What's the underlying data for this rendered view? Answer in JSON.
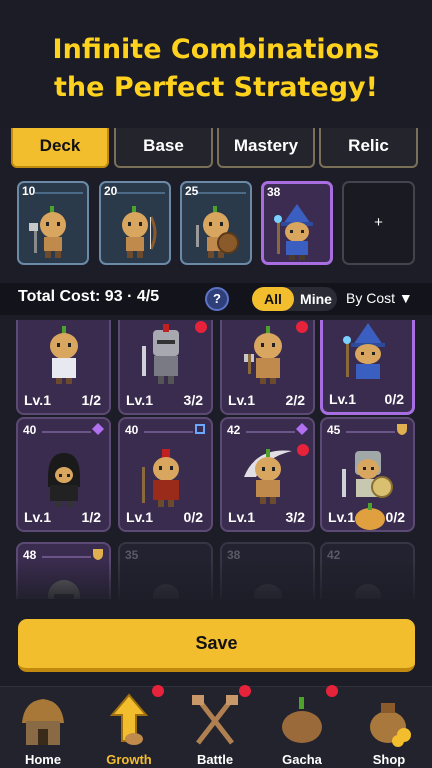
{
  "banner": {
    "line1": "Infinite Combinations",
    "line2": "the Perfect Strategy!"
  },
  "tabs": [
    {
      "label": "Deck",
      "active": true
    },
    {
      "label": "Base",
      "active": false
    },
    {
      "label": "Mastery",
      "active": false
    },
    {
      "label": "Relic",
      "active": false
    }
  ],
  "deck": [
    {
      "cost": "10"
    },
    {
      "cost": "20"
    },
    {
      "cost": "25"
    },
    {
      "cost": "38"
    }
  ],
  "add_slot": {
    "label": "+"
  },
  "summary": {
    "total_cost": "Total Cost: 93",
    "separator": "·",
    "slots": "4/5",
    "help": "?"
  },
  "filter": {
    "all": "All",
    "mine": "Mine",
    "sort": "By Cost ▼"
  },
  "units": [
    {
      "cost": "",
      "level": "Lv.1",
      "count": "1/2"
    },
    {
      "cost": "",
      "level": "Lv.1",
      "count": "3/2"
    },
    {
      "cost": "",
      "level": "Lv.1",
      "count": "2/2"
    },
    {
      "cost": "",
      "level": "Lv.1",
      "count": "0/2"
    },
    {
      "cost": "40",
      "level": "Lv.1",
      "count": "1/2"
    },
    {
      "cost": "40",
      "level": "Lv.1",
      "count": "0/2"
    },
    {
      "cost": "42",
      "level": "Lv.1",
      "count": "3/2"
    },
    {
      "cost": "45",
      "level": "Lv.1",
      "count": "0/2"
    },
    {
      "cost": "48",
      "level": "",
      "count": ""
    },
    {
      "cost": "35",
      "level": "",
      "count": ""
    },
    {
      "cost": "38",
      "level": "",
      "count": ""
    },
    {
      "cost": "42",
      "level": "",
      "count": ""
    }
  ],
  "save": {
    "label": "Save"
  },
  "nav": [
    {
      "label": "Home",
      "icon": "hut-icon"
    },
    {
      "label": "Growth",
      "icon": "up-arrow-icon"
    },
    {
      "label": "Battle",
      "icon": "crossed-shovels-icon"
    },
    {
      "label": "Gacha",
      "icon": "potato-icon"
    },
    {
      "label": "Shop",
      "icon": "coin-bag-icon"
    }
  ],
  "colors": {
    "accent": "#f3be2e",
    "banner_text": "#ffd21e",
    "rare_border": "#a86de0",
    "notification": "#e6233a"
  }
}
